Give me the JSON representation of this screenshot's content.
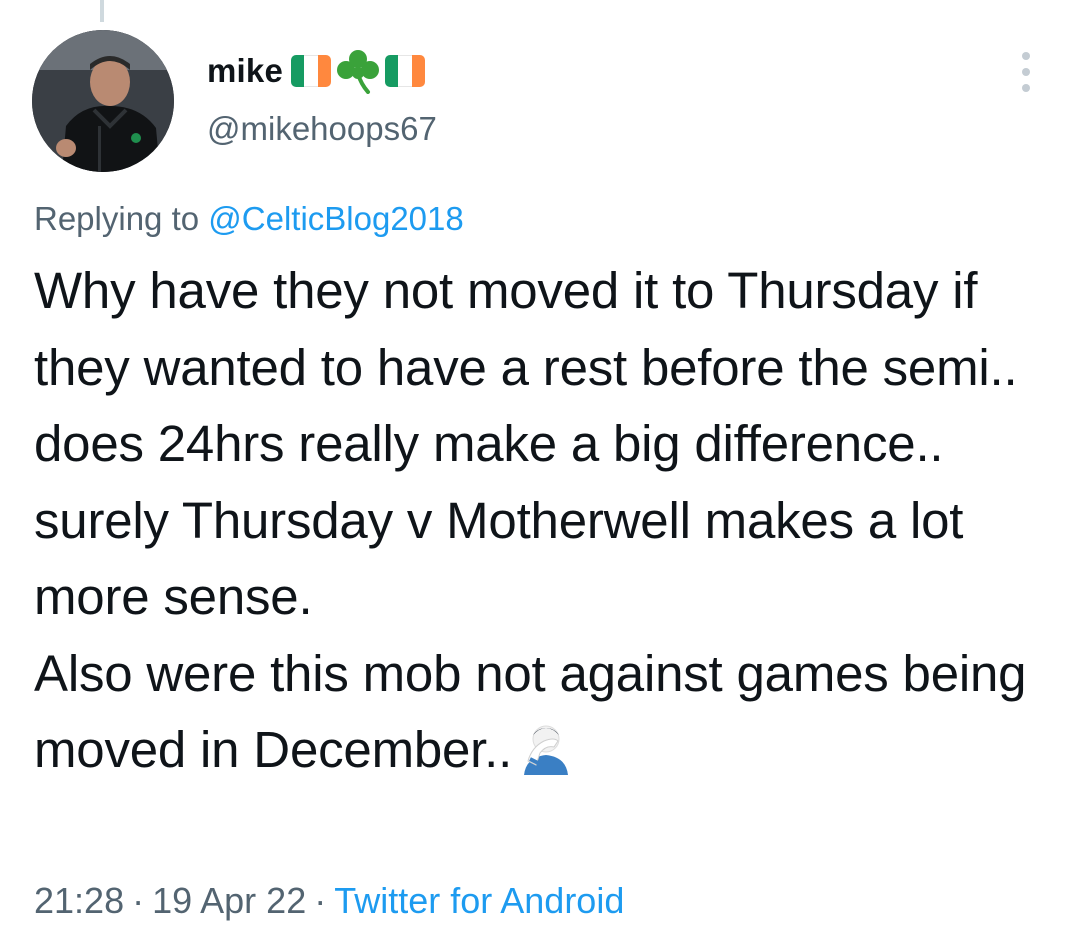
{
  "tweet": {
    "author": {
      "display_name": "mike",
      "handle": "@mikehoops67",
      "name_emoji": [
        "flag-ireland-icon",
        "shamrock-icon",
        "flag-ireland-icon"
      ],
      "avatar_icon": "user-avatar-photo"
    },
    "replying_prefix": "Replying to ",
    "replying_to": "@CelticBlog2018",
    "paragraphs": [
      "Why have they not moved it to Thursday if they wanted to have a rest before the semi.. does 24hrs really make a big difference.. surely Thursday v Motherwell makes a lot more sense.",
      "Also were this mob not against games being moved in December.."
    ],
    "trailing_emoji": "facepalm-emoji",
    "time": "21:28",
    "date": "19 Apr 22",
    "separator": "·",
    "source": "Twitter for Android",
    "more_icon": "more-options-icon"
  },
  "colors": {
    "text_primary": "#0f1419",
    "text_secondary": "#536471",
    "link": "#1d9bf0",
    "flag_green": "#169b62",
    "flag_white": "#ffffff",
    "flag_orange": "#ff883e",
    "shamrock": "#3aa23a"
  }
}
